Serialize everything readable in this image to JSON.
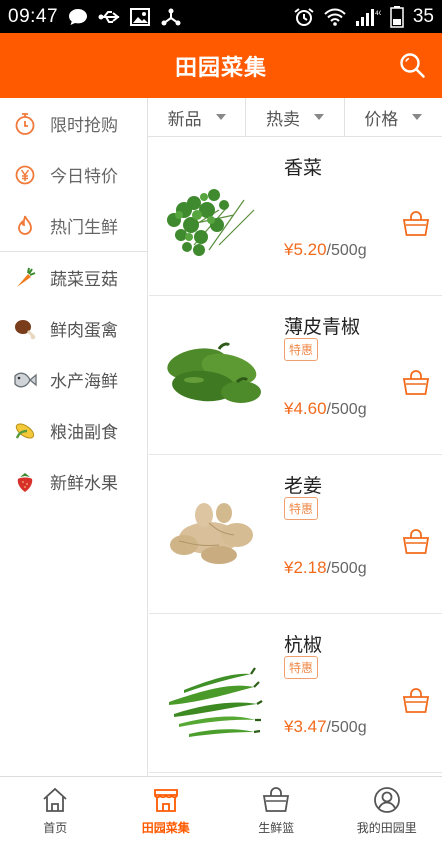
{
  "status_bar": {
    "time": "09:47",
    "battery": "35",
    "left_icons": [
      "chat-bubble-icon",
      "usb-icon",
      "image-icon",
      "share-icon"
    ],
    "right_icons": [
      "alarm-icon",
      "wifi-icon",
      "signal-4g-icon",
      "battery-icon"
    ]
  },
  "header": {
    "title": "田园菜集",
    "search_icon": "search-icon",
    "background": "#ff5a00"
  },
  "sidebar": {
    "items": [
      {
        "label": "限时抢购",
        "icon": "stopwatch-icon"
      },
      {
        "label": "今日特价",
        "icon": "yen-coin-icon"
      },
      {
        "label": "热门生鲜",
        "icon": "flame-icon"
      },
      {
        "label": "蔬菜豆菇",
        "icon": "carrot-icon"
      },
      {
        "label": "鲜肉蛋禽",
        "icon": "drumstick-icon"
      },
      {
        "label": "水产海鲜",
        "icon": "fish-icon"
      },
      {
        "label": "粮油副食",
        "icon": "corn-icon"
      },
      {
        "label": "新鲜水果",
        "icon": "strawberry-icon"
      }
    ]
  },
  "filters": [
    {
      "label": "新品"
    },
    {
      "label": "热卖"
    },
    {
      "label": "价格"
    }
  ],
  "products": [
    {
      "name": "香菜",
      "badge": "",
      "price": "¥5.20",
      "unit": "/500g",
      "image": "cilantro-image"
    },
    {
      "name": "薄皮青椒",
      "badge": "特惠",
      "price": "¥4.60",
      "unit": "/500g",
      "image": "green-pepper-image"
    },
    {
      "name": "老姜",
      "badge": "特惠",
      "price": "¥2.18",
      "unit": "/500g",
      "image": "ginger-image"
    },
    {
      "name": "杭椒",
      "badge": "特惠",
      "price": "¥3.47",
      "unit": "/500g",
      "image": "hang-chili-image"
    }
  ],
  "tabs": [
    {
      "label": "首页",
      "icon": "home-icon",
      "active": false
    },
    {
      "label": "田园菜集",
      "icon": "market-stall-icon",
      "active": true
    },
    {
      "label": "生鲜篮",
      "icon": "basket-icon",
      "active": false
    },
    {
      "label": "我的田园里",
      "icon": "user-icon",
      "active": false
    }
  ],
  "colors": {
    "accent": "#ff5a00",
    "price": "#f26b1d",
    "badge": "#f08a4b"
  }
}
